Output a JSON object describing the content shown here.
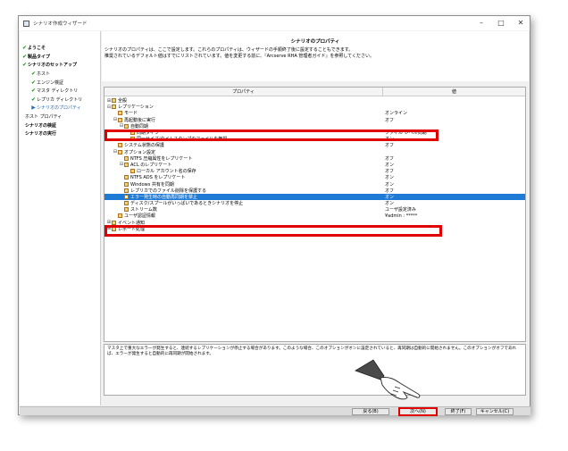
{
  "window": {
    "title": "シナリオ作成ウィザード",
    "controls": [
      "–",
      "□",
      "✕"
    ]
  },
  "sidebar": {
    "steps": [
      {
        "label": "ようこそ",
        "level": 0,
        "state": "done"
      },
      {
        "label": "製品タイプ",
        "level": 0,
        "state": "done"
      },
      {
        "label": "シナリオのセットアップ",
        "level": 0,
        "state": "expanded"
      },
      {
        "label": "ホスト",
        "level": 1,
        "state": "done"
      },
      {
        "label": "エンジン検証",
        "level": 1,
        "state": "done"
      },
      {
        "label": "マスタ ディレクトリ",
        "level": 1,
        "state": "done"
      },
      {
        "label": "レプリカ ディレクトリ",
        "level": 1,
        "state": "done"
      },
      {
        "label": "シナリオのプロパティ",
        "level": 1,
        "state": "current"
      },
      {
        "label": "ホスト プロパティ",
        "level": 2,
        "state": "pending"
      },
      {
        "label": "シナリオの検証",
        "level": 0,
        "state": "pending"
      },
      {
        "label": "シナリオの実行",
        "level": 0,
        "state": "pending"
      }
    ]
  },
  "main": {
    "section_title": "シナリオのプロパティ",
    "description_line1": "シナリオのプロパティは、ここで設定します。これらのプロパティは、ウィザードの手順終了後に設定することもできます。",
    "description_line2": "推奨されているデフォルト値はすでにリストされています。値を変更する前に、『Arcserve RHA 管理者ガイド』を参照してください。"
  },
  "grid": {
    "col_property": "プロパティ",
    "col_value": "値",
    "rows": [
      {
        "indent": 0,
        "toggle": "⊞",
        "label": "全般",
        "value": ""
      },
      {
        "indent": 0,
        "toggle": "⊟",
        "label": "レプリケーション",
        "value": ""
      },
      {
        "indent": 1,
        "toggle": "",
        "label": "モード",
        "value": "オンライン"
      },
      {
        "indent": 1,
        "toggle": "⊟",
        "label": "再起動後に実行",
        "value": "オフ"
      },
      {
        "indent": 2,
        "toggle": "⊟",
        "label": "自動同期",
        "value": ""
      },
      {
        "indent": 3,
        "toggle": "",
        "label": "同期タイプ",
        "value": "ファイル レベル同期"
      },
      {
        "indent": 3,
        "toggle": "",
        "label": "同一サイズ/タイムスタンプのファイルを無視",
        "value": "オン"
      },
      {
        "indent": 1,
        "toggle": "",
        "label": "システム状態の保護",
        "value": "オフ"
      },
      {
        "indent": 1,
        "toggle": "⊟",
        "label": "オプション設定",
        "value": ""
      },
      {
        "indent": 2,
        "toggle": "",
        "label": "NTFS 圧縮属性をレプリケート",
        "value": "オフ"
      },
      {
        "indent": 2,
        "toggle": "⊟",
        "label": "ACL のレプリケート",
        "value": "オン"
      },
      {
        "indent": 3,
        "toggle": "",
        "label": "ローカル アカウント名の保存",
        "value": "オフ"
      },
      {
        "indent": 2,
        "toggle": "",
        "label": "NTFS ADS をレプリケート",
        "value": "オン"
      },
      {
        "indent": 2,
        "toggle": "",
        "label": "Windows 共有を同期",
        "value": "オン"
      },
      {
        "indent": 2,
        "toggle": "",
        "label": "レプリカでのファイル削除を保護する",
        "value": "オフ"
      },
      {
        "indent": 2,
        "toggle": "",
        "label": "エラー発生時の自動再同期を禁止",
        "value": "オン",
        "selected": true
      },
      {
        "indent": 2,
        "toggle": "",
        "label": "ディスク/スプールがいっぱいであるときシナリオを停止",
        "value": "オン"
      },
      {
        "indent": 2,
        "toggle": "",
        "label": "ストリーム数",
        "value": "ユーザ設定済み"
      },
      {
        "indent": 1,
        "toggle": "",
        "label": "ユーザ認証情報",
        "value": "¥admin : *****"
      },
      {
        "indent": 0,
        "toggle": "⊞",
        "label": "イベント通知",
        "value": ""
      },
      {
        "indent": 0,
        "toggle": "⊞",
        "label": "レポート処理",
        "value": ""
      }
    ]
  },
  "description_panel": {
    "text": "マスタ上で重大なエラーが発生すると、連続するレプリケーションが停止する場合があります。このような場合、このオプションがオンに設定されていると、再同期は自動的に開始されません。このオプションがオフであれば、エラーが発生すると自動的に再同期が開始されます。"
  },
  "footer": {
    "back_label": "戻る(B)",
    "next_label": "次へ(N)",
    "finish_label": "終了(F)",
    "cancel_label": "キャンセル(C)"
  },
  "colors": {
    "selection": "#1f7ad6",
    "highlight": "#e00000",
    "done_check": "#1a8a1a"
  }
}
